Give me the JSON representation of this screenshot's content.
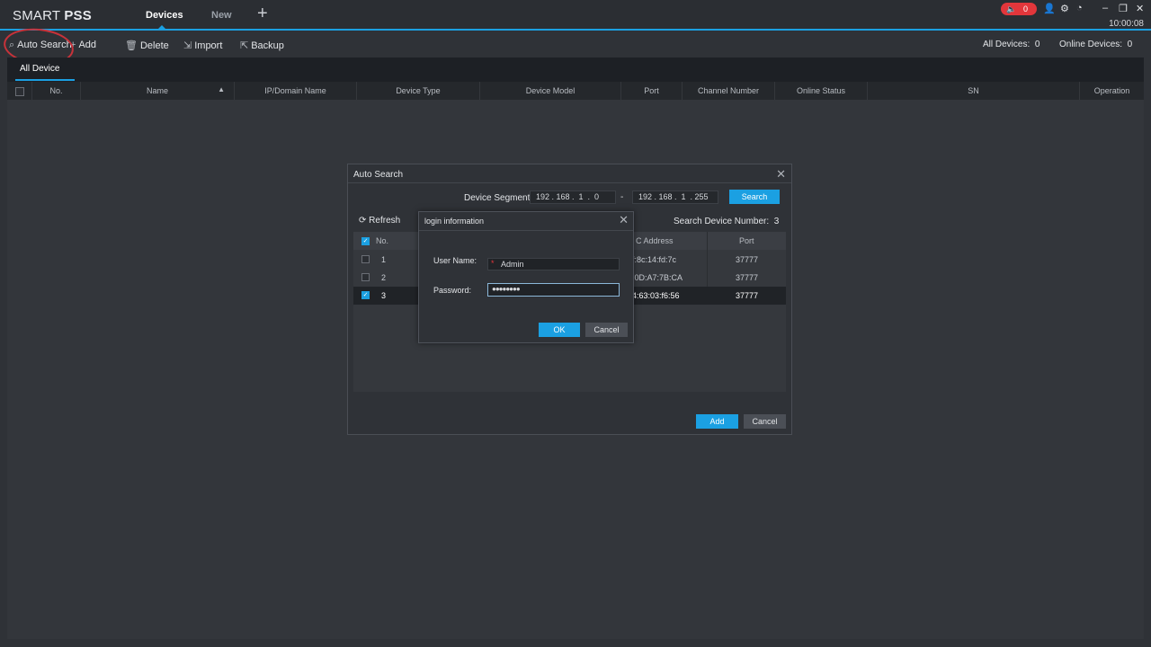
{
  "app": {
    "logo_prefix": "SMART ",
    "logo_bold": "PSS",
    "tabs": [
      {
        "label": "Devices"
      },
      {
        "label": "New"
      }
    ],
    "add_tab_label": "+",
    "alarm_count": "0",
    "time": "10:00:08"
  },
  "toolbar": {
    "auto_search": "Auto Search",
    "add": "Add",
    "delete": "Delete",
    "import": "Import",
    "backup": "Backup",
    "all_devices_label": "All Devices:",
    "all_devices_value": "0",
    "online_devices_label": "Online Devices:",
    "online_devices_value": "0"
  },
  "subtab": {
    "label": "All Device"
  },
  "main_table": {
    "columns": [
      "No.",
      "Name",
      "IP/Domain Name",
      "Device Type",
      "Device Model",
      "Port",
      "Channel Number",
      "Online Status",
      "SN",
      "Operation"
    ]
  },
  "auto_search": {
    "title": "Auto Search",
    "segment_label": "Device Segment:",
    "start_ip": "192 . 168 .  1  .  0",
    "end_ip": "192 . 168 .  1  . 255",
    "dash": "-",
    "search_btn": "Search",
    "refresh": "Refresh",
    "search_count_label": "Search Device Number:",
    "search_count_value": "3",
    "columns": {
      "no": "No.",
      "mac": "C Address",
      "port": "Port"
    },
    "rows": [
      {
        "no": "1",
        "mac": "f:8c:14:fd:7c",
        "port": "37777",
        "checked": false
      },
      {
        "no": "2",
        "mac": ":0D:A7:7B:CA",
        "port": "37777",
        "checked": false
      },
      {
        "no": "3",
        "mac": "4:63:03:f6:56",
        "port": "37777",
        "checked": true
      }
    ],
    "add_btn": "Add",
    "cancel_btn": "Cancel"
  },
  "login": {
    "title": "login information",
    "user_label": "User Name:",
    "user_value": "Admin",
    "required_mark": "*",
    "pass_label": "Password:",
    "pass_value": "●●●●●●●●",
    "ok_btn": "OK",
    "cancel_btn": "Cancel"
  }
}
